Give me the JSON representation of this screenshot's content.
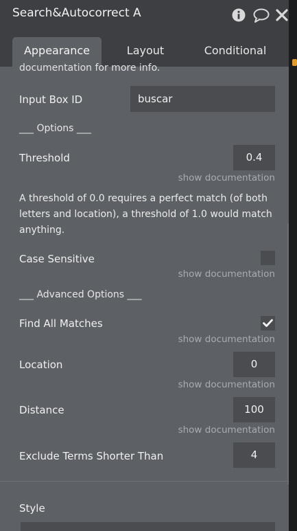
{
  "window": {
    "title": "Search&Autocorrect A"
  },
  "tabs": [
    {
      "label": "Appearance",
      "active": true
    },
    {
      "label": "Layout",
      "active": false
    },
    {
      "label": "Conditional",
      "active": false
    }
  ],
  "content": {
    "truncated_text": "documentation for more info.",
    "input_box_id": {
      "label": "Input Box ID",
      "value": "buscar"
    },
    "options_header": "___ Options ___",
    "threshold": {
      "label": "Threshold",
      "value": "0.4",
      "doc_link": "show documentation"
    },
    "threshold_help": "A threshold of 0.0 requires a perfect match (of both letters and location), a threshold of 1.0 would match anything.",
    "case_sensitive": {
      "label": "Case Sensitive",
      "checked": false,
      "doc_link": "show documentation"
    },
    "advanced_header": "___ Advanced Options ___",
    "find_all_matches": {
      "label": "Find All Matches",
      "checked": true,
      "doc_link": "show documentation"
    },
    "location": {
      "label": "Location",
      "value": "0",
      "doc_link": "show documentation"
    },
    "distance": {
      "label": "Distance",
      "value": "100",
      "doc_link": "show documentation"
    },
    "exclude_terms": {
      "label": "Exclude Terms Shorter Than",
      "value": "4"
    },
    "style": {
      "label": "Style"
    }
  },
  "colors": {
    "panel": "#5d6064",
    "header": "#3d3f42",
    "input": "#4a4c50",
    "accent": "#e09a2a"
  },
  "icons": [
    "info-icon",
    "comment-icon",
    "close-icon",
    "checkmark-icon"
  ]
}
